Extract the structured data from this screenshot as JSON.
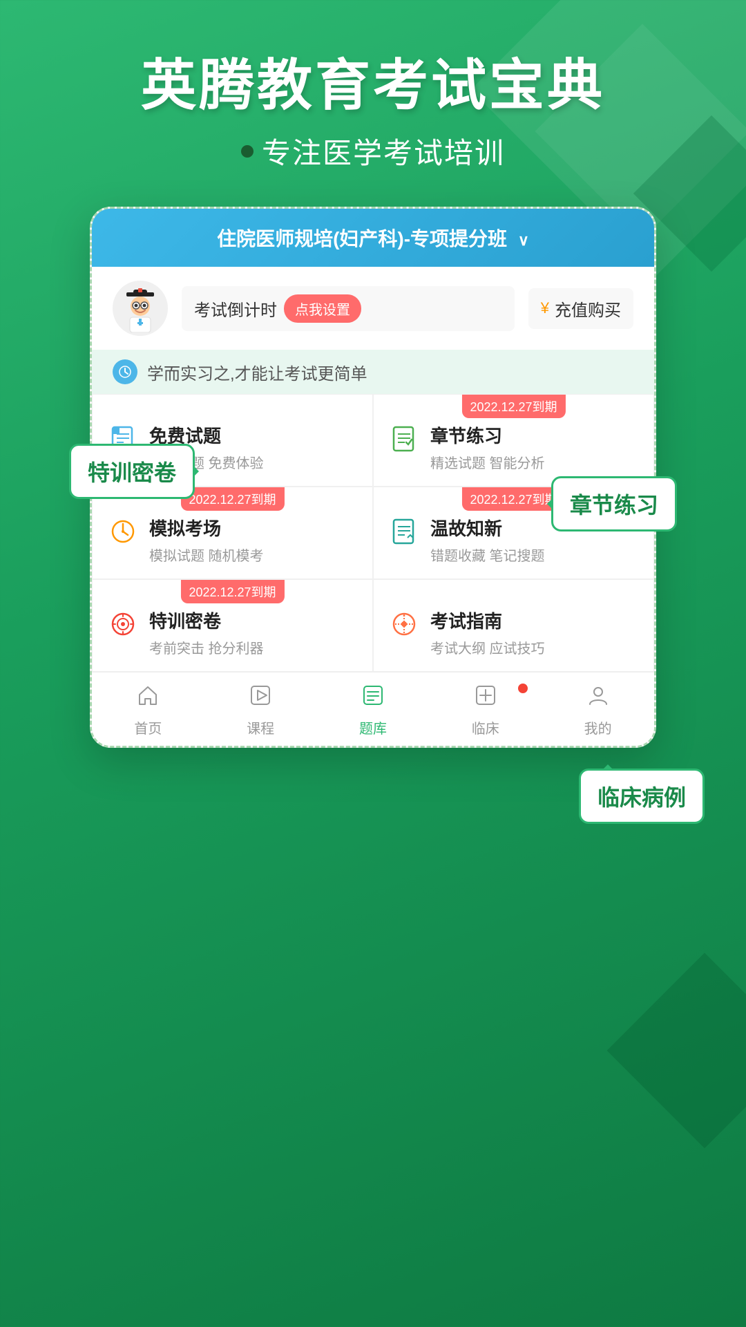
{
  "app": {
    "name": "英腾教育考试宝典",
    "tagline": "专注医学考试培训",
    "tagline_dot": true
  },
  "header_bar": {
    "course_name": "住院医师规培(妇产科)-专项提分班",
    "dropdown_symbol": "∨"
  },
  "user_bar": {
    "countdown_label": "考试倒计时",
    "countdown_btn": "点我设置",
    "recharge_label": "充值购买",
    "money_icon": "¥"
  },
  "motto": {
    "text": "学而实习之,才能让考试更简单"
  },
  "menu_items": [
    {
      "id": "free-questions",
      "title": "免费试题",
      "desc": "精选好题 免费体验",
      "icon_type": "document-blue",
      "badge": null
    },
    {
      "id": "chapter-practice",
      "title": "章节练习",
      "desc": "精选试题 智能分析",
      "icon_type": "document-green",
      "badge": "2022.12.27到期"
    },
    {
      "id": "mock-exam",
      "title": "模拟考场",
      "desc": "模拟试题 随机模考",
      "icon_type": "clock-orange",
      "badge": "2022.12.27到期"
    },
    {
      "id": "review",
      "title": "温故知新",
      "desc": "错题收藏 笔记搜题",
      "icon_type": "document-teal",
      "badge": "2022.12.27到期"
    },
    {
      "id": "special-exam",
      "title": "特训密卷",
      "desc": "考前突击 抢分利器",
      "icon_type": "target-red",
      "badge": "2022.12.27到期"
    },
    {
      "id": "exam-guide",
      "title": "考试指南",
      "desc": "考试大纲 应试技巧",
      "icon_type": "compass-coral",
      "badge": null
    }
  ],
  "bottom_nav": [
    {
      "id": "home",
      "label": "首页",
      "icon": "home",
      "active": false
    },
    {
      "id": "course",
      "label": "课程",
      "icon": "play",
      "active": false
    },
    {
      "id": "questions",
      "label": "题库",
      "icon": "list",
      "active": true
    },
    {
      "id": "clinical",
      "label": "临床",
      "icon": "clinical",
      "active": false,
      "has_dot": true
    },
    {
      "id": "mine",
      "label": "我的",
      "icon": "person",
      "active": false
    }
  ],
  "callouts": {
    "chapter": "章节练习",
    "special": "特训密卷",
    "clinical": "临床病例"
  }
}
